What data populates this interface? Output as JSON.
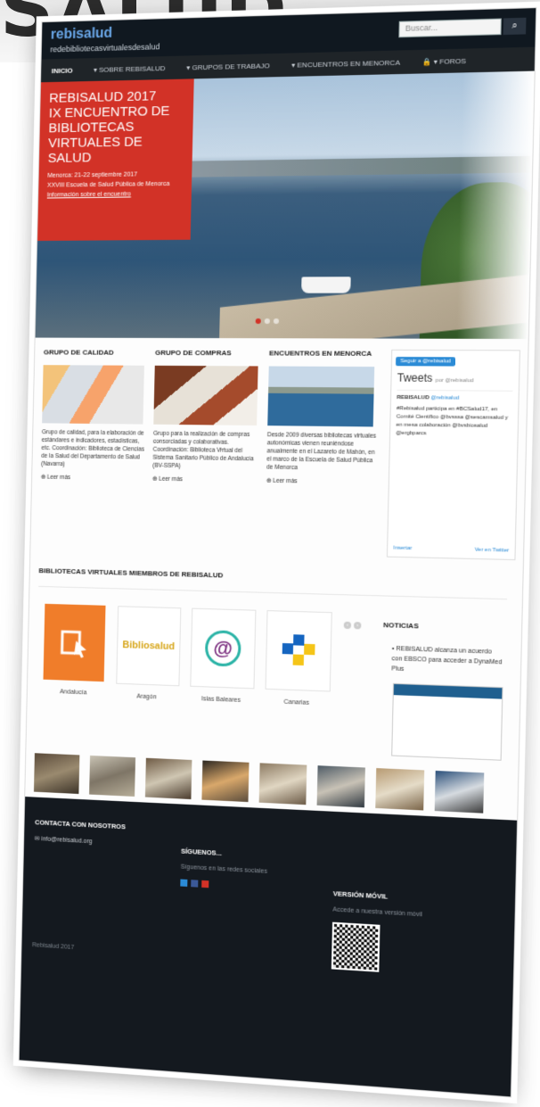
{
  "background_title": "SALUD",
  "header": {
    "logo_line1": "rebisalud",
    "logo_line2": "redebibliotecasvirtualesdesalud",
    "search_placeholder": "Buscar..."
  },
  "nav": [
    "Inicio",
    "Sobre Rebisalud",
    "Grupos de trabajo",
    "Encuentros en Menorca",
    "Foros"
  ],
  "promo": {
    "title_lines": [
      "REBISALUD 2017",
      "IX ENCUENTRO DE",
      "BIBLIOTECAS",
      "VIRTUALES DE",
      "SALUD"
    ],
    "dates": "Menorca: 21-22 septiembre 2017",
    "venue": "XXVIII Escuela de Salud Pública de Menorca",
    "link": "Información sobre el encuentro"
  },
  "columns": [
    {
      "title": "GRUPO DE CALIDAD",
      "text": "Grupo de calidad, para la elaboración de estándares e indicadores, estadísticas, etc. Coordinación: Biblioteca de Ciencias de la Salud del Departamento de Salud (Navarra)",
      "more": "Leer más"
    },
    {
      "title": "GRUPO DE COMPRAS",
      "text": "Grupo para la realización de compras consorciadas y colaborativas. Coordinación: Biblioteca Virtual del Sistema Sanitario Público de Andalucía (BV-SSPA)",
      "more": "Leer más"
    },
    {
      "title": "ENCUENTROS EN MENORCA",
      "text": "Desde 2009 diversas bibliotecas virtuales autonómicas vienen reuniéndose anualmente en el Lazareto de Mahón, en el marco de la Escuela de Salud Pública de Menorca",
      "more": "Leer más"
    }
  ],
  "twitter": {
    "follow": "Seguir a @rebisalud",
    "title": "Tweets",
    "by": "por @rebisalud",
    "account": "REBISALUD",
    "handle": "@rebisalud",
    "tweet": "#Rebisalud participa en #BCSalud17, en Comité Científico @bvsssa @sescamsalud y en mesa colaboración @bvsbiosalud @ergbparcs",
    "embed": "Insertar",
    "view": "Ver en Twitter"
  },
  "bibliotecas_title": "BIBLIOTECAS VIRTUALES MIEMBROS DE REBISALUD",
  "bibliotecas": [
    {
      "name": "Andalucía"
    },
    {
      "name": "Aragón",
      "logo_text": "Bibliosalud"
    },
    {
      "name": "Islas Baleares"
    },
    {
      "name": "Canarias"
    }
  ],
  "noticias": {
    "title": "NOTICIAS",
    "item": "REBISALUD alcanza un acuerdo con EBSCO para acceder a DynaMed Plus"
  },
  "footer": {
    "contact_title": "CONTACTA CON NOSOTROS",
    "contact_email": "info@rebisalud.org",
    "follow_title": "SÍGUENOS...",
    "follow_text": "Síguenos en las redes sociales",
    "mobile_title": "VERSIÓN MÓVIL",
    "mobile_text": "Accede a nuestra versión móvil",
    "copyright": "Rebisalud 2017"
  },
  "colors": {
    "promo_red": "#d23227",
    "topbar": "#101820",
    "footer": "#14191f",
    "twitter_blue": "#2b8bd6"
  }
}
